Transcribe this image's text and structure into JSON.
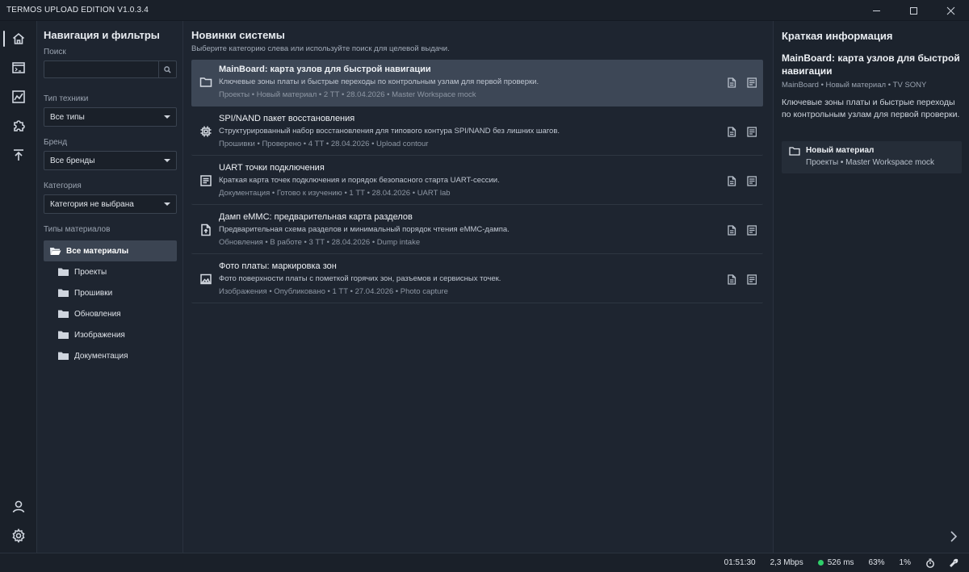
{
  "window": {
    "title": "TERMOS UPLOAD EDITION V1.0.3.4"
  },
  "rail": {
    "items": [
      {
        "icon": "home-icon",
        "active": true
      },
      {
        "icon": "terminal-icon"
      },
      {
        "icon": "chart-icon"
      },
      {
        "icon": "puzzle-icon"
      },
      {
        "icon": "upload-icon"
      }
    ],
    "bottom": [
      {
        "icon": "user-icon"
      },
      {
        "icon": "gear-icon"
      }
    ]
  },
  "filters": {
    "title": "Навигация и фильтры",
    "search_label": "Поиск",
    "search_value": "",
    "tech_label": "Тип техники",
    "tech_value": "Все типы",
    "brand_label": "Бренд",
    "brand_value": "Все бренды",
    "category_label": "Категория",
    "category_value": "Категория не выбрана",
    "types_label": "Типы материалов",
    "tree": {
      "root": "Все материалы",
      "children": [
        "Проекты",
        "Прошивки",
        "Обновления",
        "Изображения",
        "Документация"
      ]
    }
  },
  "main": {
    "title": "Новинки системы",
    "subtitle": "Выберите категорию слева или используйте поиск для целевой выдачи.",
    "items": [
      {
        "icon": "folder-icon",
        "title": "MainBoard: карта узлов для быстрой навигации",
        "desc": "Ключевые зоны платы и быстрые переходы по контрольным узлам для первой проверки.",
        "meta": "Проекты • Новый материал • 2 ТТ • 28.04.2026 • Master Workspace mock",
        "selected": true
      },
      {
        "icon": "chip-icon",
        "title": "SPI/NAND пакет восстановления",
        "desc": "Структурированный набор восстановления для типового контура SPI/NAND без лишних шагов.",
        "meta": "Прошивки • Проверено • 4 ТТ • 28.04.2026 • Upload contour"
      },
      {
        "icon": "document-icon",
        "title": "UART точки подключения",
        "desc": "Краткая карта точек подключения и порядок безопасного старта UART-сессии.",
        "meta": "Документация • Готово к изучению • 1 ТТ • 28.04.2026 • UART lab"
      },
      {
        "icon": "file-upload-icon",
        "title": "Дамп eMMC: предварительная карта разделов",
        "desc": "Предварительная схема разделов и минимальный порядок чтения eMMC-дампа.",
        "meta": "Обновления • В работе • 3 ТТ • 28.04.2026 • Dump intake"
      },
      {
        "icon": "image-icon",
        "title": "Фото платы: маркировка зон",
        "desc": "Фото поверхности платы с пометкой горячих зон, разъемов и сервисных точек.",
        "meta": "Изображения • Опубликовано • 1 ТТ • 27.04.2026 • Photo capture"
      }
    ]
  },
  "info": {
    "title": "Краткая информация",
    "item_title": "MainBoard: карта узлов для быстрой навигации",
    "item_meta": "MainBoard • Новый материал • TV SONY",
    "item_desc": "Ключевые зоны платы и быстрые переходы по контрольным узлам для первой проверки.",
    "card_title": "Новый материал",
    "card_meta": "Проекты • Master Workspace mock"
  },
  "status": {
    "time": "01:51:30",
    "speed": "2,3 Mbps",
    "ping": "526 ms",
    "cpu": "63%",
    "mem": "1%",
    "ping_color": "#2fcf6a"
  },
  "colors": {
    "background": "#1e2530",
    "selected_row": "#3d4756",
    "accent": "#2fcf6a"
  }
}
